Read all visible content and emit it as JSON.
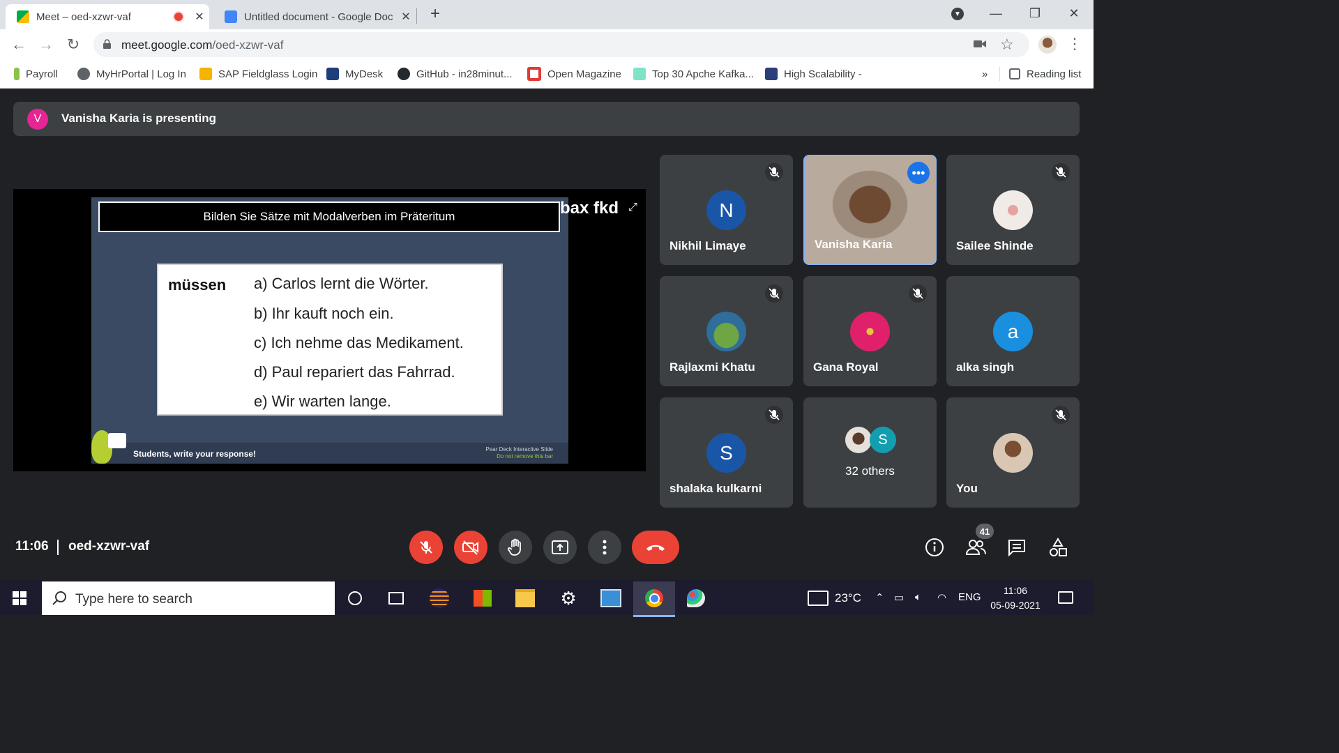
{
  "browser": {
    "tabs": [
      {
        "title": "Meet – oed-xzwr-vaf",
        "active": true
      },
      {
        "title": "Untitled document - Google Doc",
        "active": false
      }
    ],
    "url_host": "meet.google.com",
    "url_path": "/oed-xzwr-vaf",
    "bookmarks": [
      "Payroll",
      "MyHrPortal | Log In",
      "SAP Fieldglass Login",
      "MyDesk",
      "GitHub - in28minut...",
      "Open Magazine",
      "Top 30 Apche Kafka...",
      "High Scalability -"
    ],
    "overflow_label": "»",
    "reading_list": "Reading list"
  },
  "meet": {
    "presenter_initial": "V",
    "presenting_text": "Vanisha Karia is presenting",
    "slide": {
      "title": "Bilden Sie Sätze mit Modalverben im Präteritum",
      "verb": "müssen",
      "sentences": [
        "a) Carlos lernt die Wörter.",
        "b) Ihr kauft noch ein.",
        "c) Ich nehme das Medikament.",
        "d) Paul repariert das Fahrrad.",
        "e) Wir warten lange."
      ],
      "footer": "Students, write your response!",
      "peardeck_line1": "Pear Deck Interactive Slide",
      "peardeck_line2": "Do not remove this bar"
    },
    "overlay_text": "bax fkd",
    "participants": [
      {
        "name": "Nikhil Limaye",
        "initial": "N",
        "color": "#1a56a8"
      },
      {
        "name": "Vanisha Karia",
        "initial": "",
        "color": "#8a6a52"
      },
      {
        "name": "Sailee Shinde",
        "initial": "",
        "color": "#e8ddd6"
      },
      {
        "name": "Rajlaxmi Khatu",
        "initial": "",
        "color": "#4b8f4a"
      },
      {
        "name": "Gana Royal",
        "initial": "",
        "color": "#e0206a"
      },
      {
        "name": "alka singh",
        "initial": "a",
        "color": "#1a8fe0"
      },
      {
        "name": "shalaka kulkarni",
        "initial": "S",
        "color": "#1a56a8"
      },
      {
        "name": "32 others",
        "initial": "S",
        "color": "#129eaf"
      },
      {
        "name": "You",
        "initial": "",
        "color": "#c9b29a"
      }
    ],
    "time": "11:06",
    "meeting_code": "oed-xzwr-vaf",
    "participant_count": "41"
  },
  "taskbar": {
    "search_placeholder": "Type here to search",
    "temperature": "23°C",
    "language": "ENG",
    "time": "11:06",
    "date": "05-09-2021"
  }
}
